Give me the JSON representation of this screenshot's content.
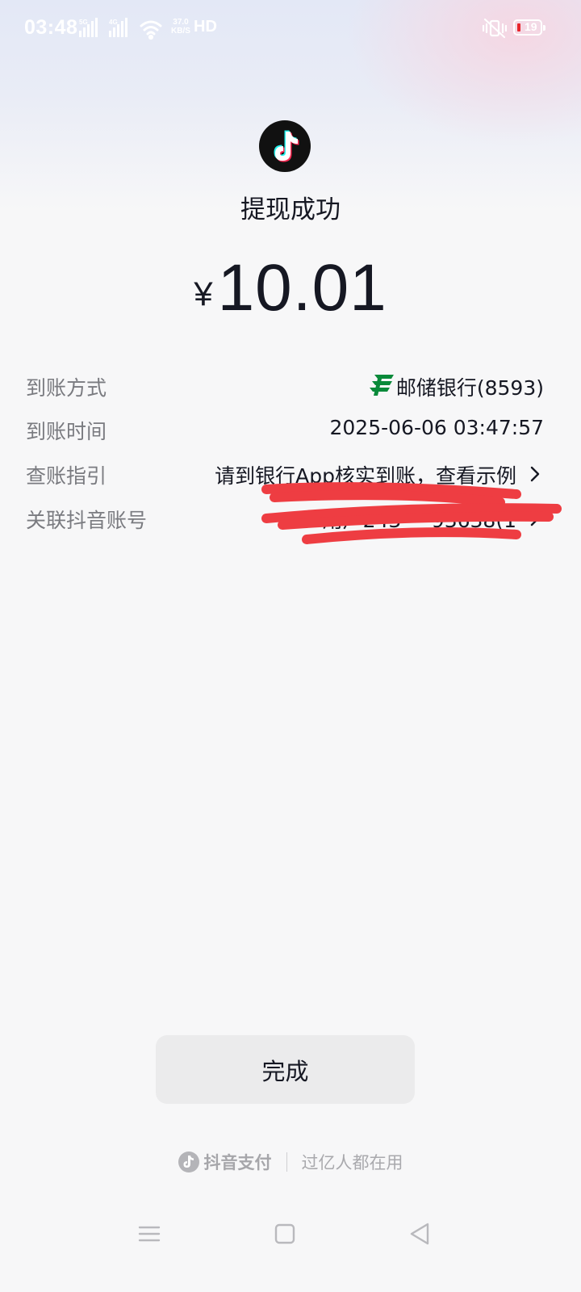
{
  "status_bar": {
    "time": "03:48",
    "net_speed_value": "37.0",
    "net_speed_unit": "KB/S",
    "hd_label": "HD",
    "battery": "19"
  },
  "header": {
    "app_icon": "douyin-logo-icon",
    "title": "提现成功"
  },
  "amount": {
    "currency_symbol": "¥",
    "value": "10.01"
  },
  "details": {
    "method": {
      "label": "到账方式",
      "bank_icon": "postal-savings-bank-icon",
      "value": "邮储银行(8593)"
    },
    "time": {
      "label": "到账时间",
      "value": "2025-06-06 03:47:57"
    },
    "guide": {
      "label": "查账指引",
      "value": "请到银行App核实到账，查看示例"
    },
    "account": {
      "label": "关联抖音账号",
      "value": "用户243***93638(1"
    }
  },
  "done_button": {
    "label": "完成"
  },
  "footer": {
    "brand_name": "抖音支付",
    "slogan": "过亿人都在用"
  },
  "nav_bar": {
    "menu_icon": "menu-icon",
    "home_icon": "home-icon",
    "back_icon": "back-icon"
  },
  "colors": {
    "redaction": "#ee3d42",
    "bank_green": "#0a8a3a",
    "text_primary": "#161823",
    "text_secondary": "#7a7b80"
  }
}
